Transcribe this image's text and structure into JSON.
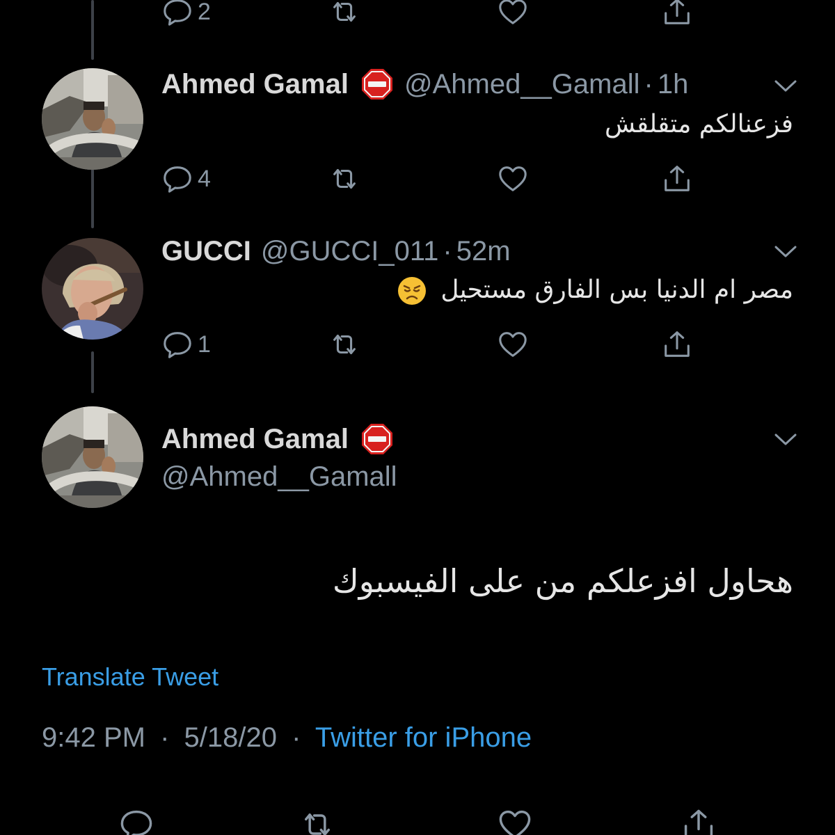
{
  "top_actions": {
    "reply_count": "2"
  },
  "tweets": [
    {
      "name": "Ahmed Gamal",
      "handle": "@Ahmed__Gamall",
      "time": "1h",
      "text": "فزعنالكم متقلقش",
      "reply_count": "4"
    },
    {
      "name": "GUCCI",
      "handle": "@GUCCI_011",
      "time": "52m",
      "text": "مصر ام الدنيا بس الفارق مستحيل",
      "reply_count": "1"
    }
  ],
  "main_tweet": {
    "name": "Ahmed Gamal",
    "handle": "@Ahmed__Gamall",
    "text": "هحاول افزعلكم من على الفيسبوك",
    "translate_label": "Translate Tweet",
    "time": "9:42 PM",
    "date": "5/18/20",
    "source": "Twitter for iPhone"
  },
  "separator": "·",
  "icons": {
    "reply": "reply-bubble-icon",
    "retweet": "retweet-icon",
    "like": "heart-icon",
    "share": "share-icon",
    "more": "chevron-down-icon",
    "badge": "stop-sign-emoji",
    "emoji": "disappointed-face-emoji"
  },
  "colors": {
    "background": "#000000",
    "text": "#d9d9d9",
    "secondary": "#8b98a5",
    "link": "#3a9ee6",
    "thread_line": "#3d4148",
    "badge_red": "#d8211f"
  }
}
